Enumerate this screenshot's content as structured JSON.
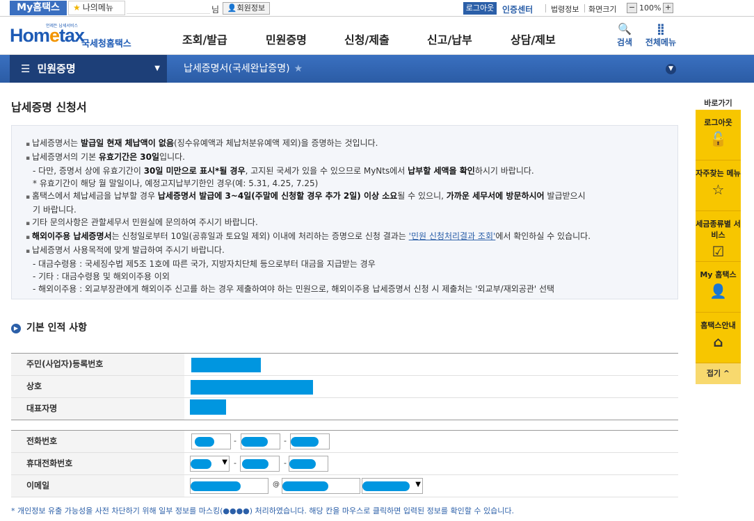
{
  "topbar": {
    "myhome": "My홈택스",
    "mymenu": "나의메뉴",
    "nim": "님",
    "member_info": "회원정보",
    "logout": "로그아웃",
    "cert": "인증센터",
    "law": "법령정보",
    "screen": "화면크기",
    "zoom_minus": "−",
    "zoom": "100%",
    "zoom_plus": "+"
  },
  "header": {
    "logo_tiny": "언제든 납세서비스",
    "logo_main1": "Hom",
    "logo_e": "e",
    "logo_main2": "tax",
    "logo_sub": "국세청홈택스",
    "nav": [
      "조회/발급",
      "민원증명",
      "신청/제출",
      "신고/납부",
      "상담/제보"
    ],
    "search": "검색",
    "all_menu": "전체메뉴"
  },
  "bar": {
    "category": "민원증명",
    "crumb": "납세증명서(국세완납증명)"
  },
  "page": {
    "title": "납세증명 신청서"
  },
  "info": {
    "l1a": "납세증명서는 ",
    "l1b": "발급일 현재 체납액이 없음",
    "l1c": "(징수유예액과 체납처분유예액 제외)을 증명하는 것입니다.",
    "l2a": "납세증명서의 기본 ",
    "l2b": "유효기간은 30일",
    "l2c": "입니다.",
    "l3a": "- 다만, 증명서 상에 유효기간이 ",
    "l3b": "30일 미만으로 표시*될 경우",
    "l3c": ", 고지된 국세가 있을 수 있으므로 MyNts에서 ",
    "l3d": "납부할 세액을 확인",
    "l3e": "하시기 바랍니다.",
    "l4": "* 유효기간이 해당 월 말일이나, 예정고지납부기한인 경우(예: 5.31, 4.25, 7.25)",
    "l5a": "홈택스에서 체납세금을 납부할 경우 ",
    "l5b": "납세증명서 발급에 3~4일(주말에 신청할 경우 추가 2일) 이상 소요",
    "l5c": "될 수 있으니, ",
    "l5d": "가까운 세무서에 방문하시어",
    "l5e": " 발급받으시",
    "l6": "기 바랍니다.",
    "l7": "기타 문의사항은 관할세무서 민원실에 문의하여 주시기 바랍니다.",
    "l8a": "해외이주용 납세증명서",
    "l8b": "는 신청일로부터 10일(공휴일과 토요일 제외) 이내에 처리하는 증명으로 신청 결과는 ",
    "l8c": "'민원 신청처리결과 조회'",
    "l8d": "에서 확인하실 수 있습니다.",
    "l9": "납세증명서 사용목적에 맞게 발급하여 주시기 바랍니다.",
    "l10": "- 대금수령용 : 국세징수법 제5조 1호에 따른 국가, 지방자치단체 등으로부터 대금을 지급받는 경우",
    "l11": "- 기타 : 대금수령용 및 해외이주용 이외",
    "l12": "- 해외이주용 : 외교부장관에게 해외이주 신고를 하는 경우 제출하여야 하는 민원으로, 해외이주용 납세증명서 신청 시 제출처는 '외교부/재외공관' 선택"
  },
  "section": {
    "title": "기본 인적 사항"
  },
  "form": {
    "rrn": "주민(사업자)등록번호",
    "company": "상호",
    "rep": "대표자명",
    "phone": "전화번호",
    "mobile": "휴대전화번호",
    "email": "이메일",
    "dash": "-",
    "at": "@"
  },
  "note": "* 개인정보 유출 가능성을 사전 차단하기 위해 일부 정보를 마스킹(●●●●) 처리하였습니다. 해당 칸을 마우스로 클릭하면 입력된 정보를 확인할 수 있습니다.",
  "quick": {
    "head": "바로가기",
    "logout": "로그아웃",
    "faq": "자주찾는 메뉴",
    "tax_service": "세금종류별 서비스",
    "myhome": "My 홈택스",
    "guide": "홈택스안내",
    "close": "접기 ^"
  }
}
